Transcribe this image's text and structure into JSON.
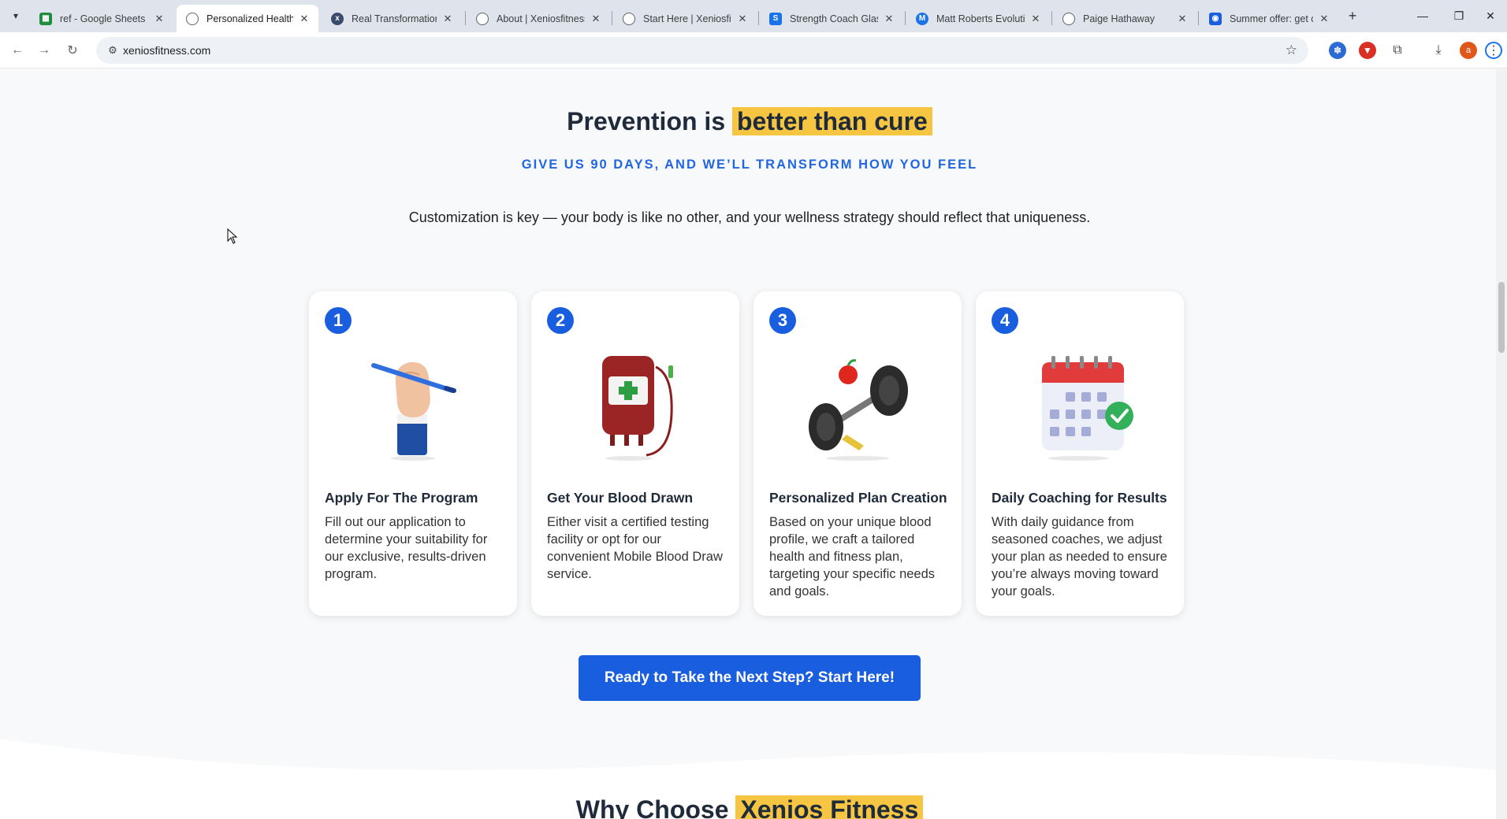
{
  "browser": {
    "tabs": [
      {
        "title": "ref - Google Sheets",
        "favicon": "sheets-icon",
        "color": "#1e8e3e"
      },
      {
        "title": "Personalized Health C",
        "favicon": "globe-icon",
        "color": "#5f6368"
      },
      {
        "title": "Real Transformations",
        "favicon": "xenios-icon",
        "color": "#3a4a6b"
      },
      {
        "title": "About | Xeniosfitness",
        "favicon": "globe-icon",
        "color": "#5f6368"
      },
      {
        "title": "Start Here | Xeniosfitn",
        "favicon": "globe-icon",
        "color": "#5f6368"
      },
      {
        "title": "Strength Coach Glasg",
        "favicon": "s-icon",
        "color": "#1a73e8"
      },
      {
        "title": "Matt Roberts Evolutio",
        "favicon": "m-icon",
        "color": "#1a73e8"
      },
      {
        "title": "Paige Hathaway",
        "favicon": "globe-icon",
        "color": "#5f6368"
      },
      {
        "title": "Summer offer: get on",
        "favicon": "blue-icon",
        "color": "#1a5ee0"
      }
    ],
    "url": "xeniosfitness.com"
  },
  "page": {
    "headline_prefix": "Prevention is",
    "headline_highlight": "better than cure",
    "subheadline": "GIVE US 90 DAYS, AND WE’LL TRANSFORM HOW YOU FEEL",
    "intro": "Customization is key — your body is like no other, and your wellness strategy should reflect that uniqueness.",
    "steps": [
      {
        "number": "1",
        "illustration": "hand-pencil-icon",
        "title": "Apply For The Program",
        "text": "Fill out our application to determine your suitability for our exclusive, results-driven program."
      },
      {
        "number": "2",
        "illustration": "blood-bag-icon",
        "title": "Get Your Blood Drawn",
        "text": "Either visit a certified testing facility or opt for our convenient Mobile Blood Draw service."
      },
      {
        "number": "3",
        "illustration": "dumbbell-icon",
        "title": "Personalized Plan Creation",
        "text": "Based on your unique blood profile, we craft a tailored health and fitness plan, targeting your specific needs and goals."
      },
      {
        "number": "4",
        "illustration": "calendar-check-icon",
        "title": "Daily Coaching for Results",
        "text": "With daily guidance from seasoned coaches, we adjust your plan as needed to ensure you’re always moving toward your goals."
      }
    ],
    "cta_label": "Ready to Take the Next Step? Start Here!",
    "next_section_prefix": "Why Choose",
    "next_section_highlight": "Xenios Fitness"
  },
  "colors": {
    "accent_blue": "#1a5ee0",
    "highlight_yellow": "#f6c542",
    "heading_dark": "#1f2a3a"
  }
}
